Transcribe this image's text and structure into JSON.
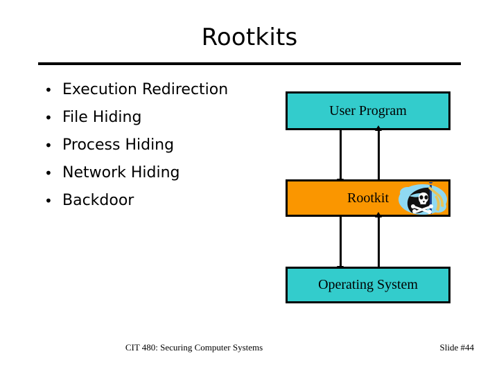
{
  "slide": {
    "title": "Rootkits",
    "bullets": [
      {
        "label": "Execution Redirection"
      },
      {
        "label": "File Hiding"
      },
      {
        "label": "Process Hiding"
      },
      {
        "label": "Network Hiding"
      },
      {
        "label": "Backdoor"
      }
    ],
    "diagram": {
      "boxes": [
        {
          "label": "User Program",
          "color": "#33CCCC"
        },
        {
          "label": "Rootkit",
          "color": "#FA9600"
        },
        {
          "label": "Operating System",
          "color": "#33CCCC"
        }
      ],
      "icon": "pirate-skull-flag-icon"
    },
    "footer": {
      "course": "CIT 480: Securing Computer Systems",
      "slide_number": "Slide #44"
    }
  },
  "colors": {
    "teal": "#33CCCC",
    "orange": "#FA9600",
    "rule": "#000000",
    "text": "#000000"
  }
}
